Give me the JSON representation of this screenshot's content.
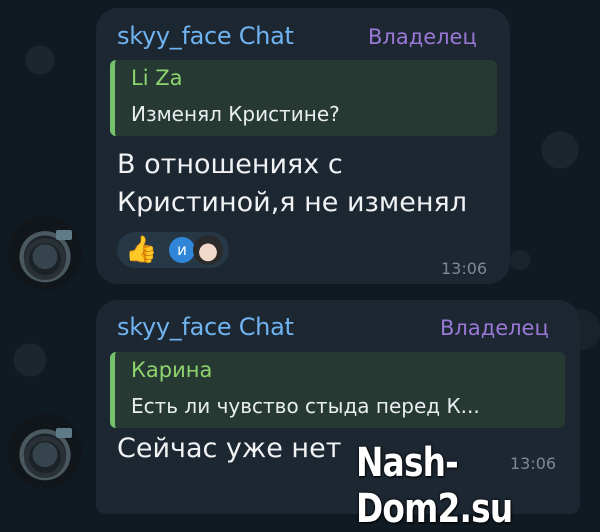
{
  "messages": [
    {
      "sender": "skyy_face Chat",
      "role": "Владелец",
      "reply": {
        "author": "Li Za",
        "text": "Изменял Кристине?"
      },
      "text_lines": [
        "В отношениях с",
        "Кристиной,я не изменял"
      ],
      "reactions": {
        "emoji": "👍",
        "badge": "и"
      },
      "time": "13:06"
    },
    {
      "sender": "skyy_face Chat",
      "role": "Владелец",
      "reply": {
        "author": "Карина",
        "text": "Есть ли чувство стыда перед К..."
      },
      "text_lines": [
        "Сейчас уже нет"
      ],
      "time": "13:06"
    }
  ],
  "watermark": "Nash-Dom2.su",
  "colors": {
    "background": "#0f1a23",
    "bubble": "#1c2732",
    "sender": "#6fb3f0",
    "role": "#9a78d8",
    "reply_bar": "#74c36c"
  }
}
